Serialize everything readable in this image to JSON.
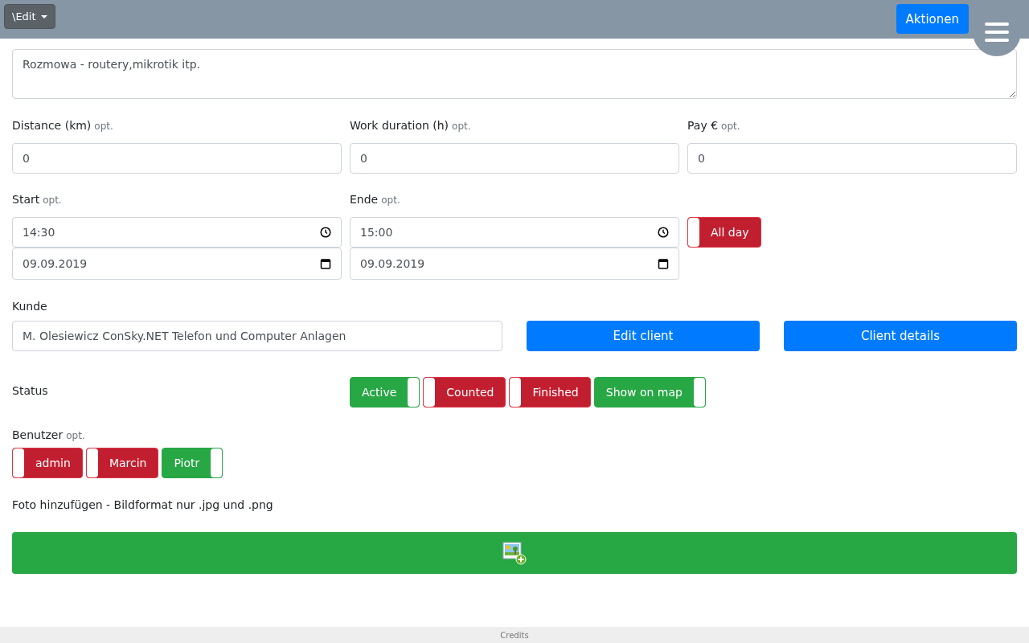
{
  "header": {
    "mode_button": "\\Edit",
    "actions_button": "Aktionen"
  },
  "description": {
    "value": "Rozmowa - routery,mikrotik itp."
  },
  "numbers": [
    {
      "label": "Distance (km)",
      "hint": "opt.",
      "value": "0"
    },
    {
      "label": "Work duration (h)",
      "hint": "opt.",
      "value": "0"
    },
    {
      "label": "Pay €",
      "hint": "opt.",
      "value": "0"
    }
  ],
  "start": {
    "label": "Start",
    "hint": "opt.",
    "time": "14:30",
    "date": "09.09.2019"
  },
  "end": {
    "label": "Ende",
    "hint": "opt.",
    "time": "15:00",
    "date": "09.09.2019"
  },
  "all_day": {
    "label": "All day",
    "on": false
  },
  "client": {
    "label": "Kunde",
    "value": "M. Olesiewicz ConSky.NET Telefon und Computer Anlagen",
    "buttons": [
      "Edit client",
      "Client details"
    ]
  },
  "status": {
    "label": "Status",
    "toggles": [
      {
        "label": "Active",
        "on": true
      },
      {
        "label": "Counted",
        "on": false
      },
      {
        "label": "Finished",
        "on": false
      },
      {
        "label": "Show on map",
        "on": true
      }
    ]
  },
  "users": {
    "label": "Benutzer",
    "hint": "opt.",
    "toggles": [
      {
        "label": "admin",
        "on": false
      },
      {
        "label": "Marcin",
        "on": false
      },
      {
        "label": "Piotr",
        "on": true
      }
    ]
  },
  "photo": {
    "label": "Foto hinzufügen - Bildformat nur .jpg und .png"
  },
  "footer": {
    "text": "Credits"
  }
}
